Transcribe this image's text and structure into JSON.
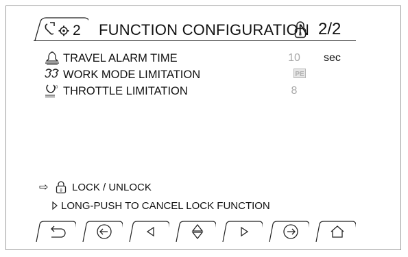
{
  "header": {
    "tab_number": "2",
    "title": "FUNCTION CONFIGURATION",
    "page": "2/2"
  },
  "rows": [
    {
      "label": "TRAVEL ALARM TIME",
      "value": "10",
      "unit": "sec",
      "icon": "travel-alarm-icon"
    },
    {
      "label": "WORK MODE LIMITATION",
      "value_badge": "PE",
      "icon": "work-mode-icon"
    },
    {
      "label": "THROTTLE LIMITATION",
      "value": "8",
      "icon": "throttle-icon"
    }
  ],
  "footer": {
    "lock_text": "LOCK / UNLOCK",
    "cancel_text": "LONG-PUSH TO CANCEL LOCK FUNCTION"
  },
  "softkeys": [
    {
      "name": "back-icon"
    },
    {
      "name": "circle-arrow-left-icon"
    },
    {
      "name": "triangle-left-icon"
    },
    {
      "name": "up-down-icon"
    },
    {
      "name": "triangle-right-icon"
    },
    {
      "name": "circle-arrow-right-icon"
    },
    {
      "name": "home-icon"
    }
  ],
  "colors": {
    "value_grey": "#a8a8a8",
    "text": "#111111"
  }
}
